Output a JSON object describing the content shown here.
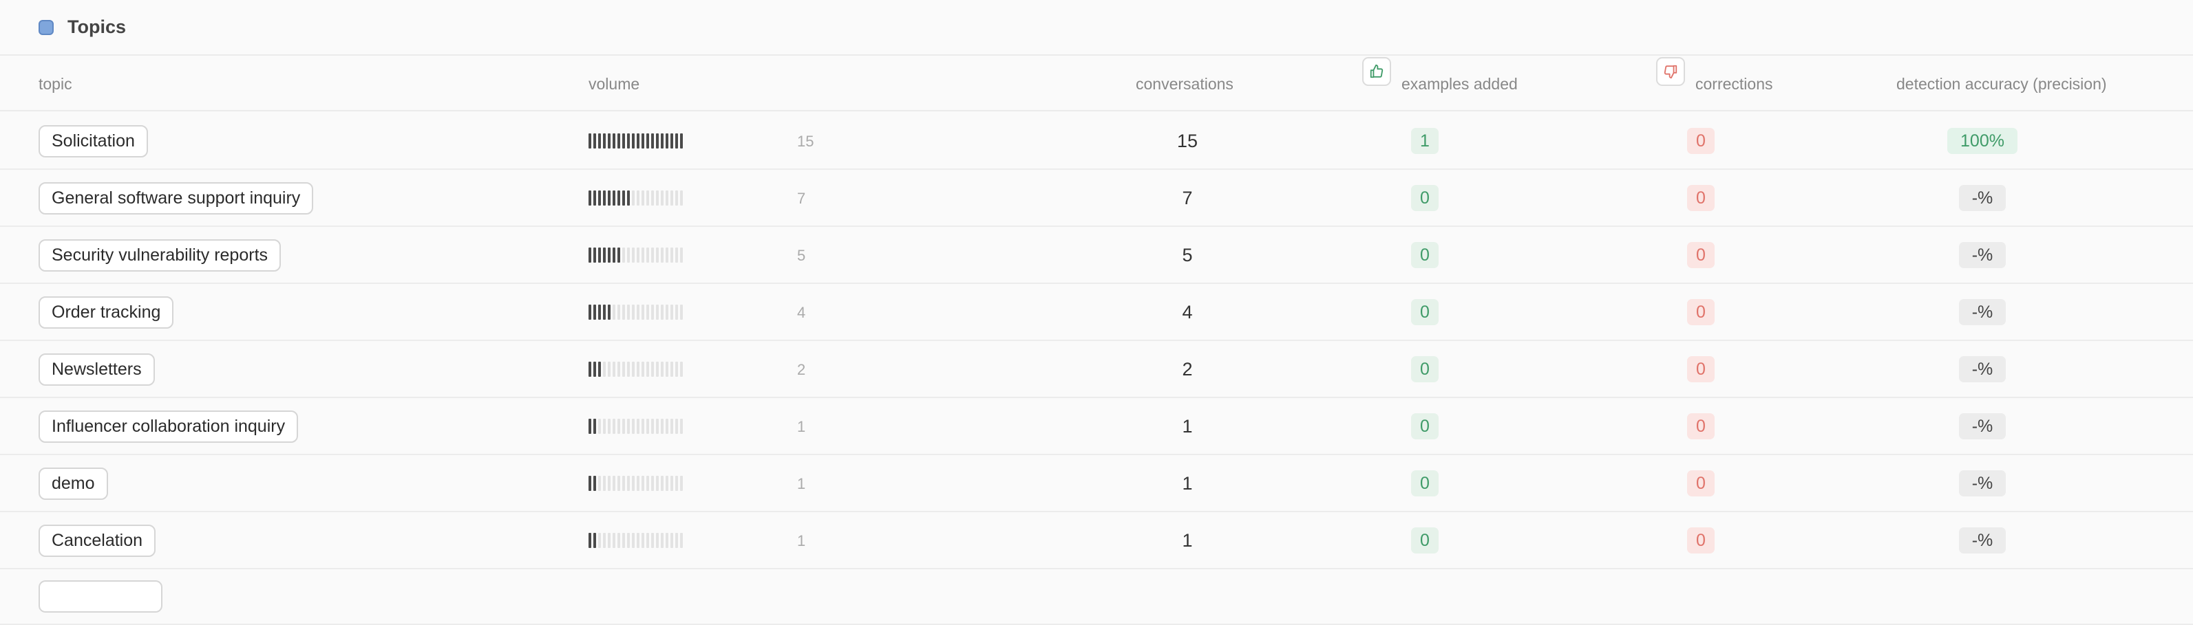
{
  "header": {
    "title": "Topics"
  },
  "columns": {
    "topic": "topic",
    "volume": "volume",
    "conversations": "conversations",
    "examples_added": "examples added",
    "corrections": "corrections",
    "accuracy": "detection accuracy (precision)"
  },
  "icons": {
    "header": "topics-square-icon",
    "examples": "thumbs-up-icon",
    "corrections": "thumbs-down-icon"
  },
  "colors": {
    "accent": "#7fa6dc",
    "positive": "#3f9b68",
    "negative": "#e0736a"
  },
  "volume_max": 15,
  "rows": [
    {
      "topic": "Solicitation",
      "volume": "15",
      "conversations": "15",
      "examples": "1",
      "corrections": "0",
      "accuracy": "100%"
    },
    {
      "topic": "General software support inquiry",
      "volume": "7",
      "conversations": "7",
      "examples": "0",
      "corrections": "0",
      "accuracy": "-%"
    },
    {
      "topic": "Security vulnerability reports",
      "volume": "5",
      "conversations": "5",
      "examples": "0",
      "corrections": "0",
      "accuracy": "-%"
    },
    {
      "topic": "Order tracking",
      "volume": "4",
      "conversations": "4",
      "examples": "0",
      "corrections": "0",
      "accuracy": "-%"
    },
    {
      "topic": "Newsletters",
      "volume": "2",
      "conversations": "2",
      "examples": "0",
      "corrections": "0",
      "accuracy": "-%"
    },
    {
      "topic": "Influencer collaboration inquiry",
      "volume": "1",
      "conversations": "1",
      "examples": "0",
      "corrections": "0",
      "accuracy": "-%"
    },
    {
      "topic": "demo",
      "volume": "1",
      "conversations": "1",
      "examples": "0",
      "corrections": "0",
      "accuracy": "-%"
    },
    {
      "topic": "Cancelation",
      "volume": "1",
      "conversations": "1",
      "examples": "0",
      "corrections": "0",
      "accuracy": "-%"
    }
  ]
}
